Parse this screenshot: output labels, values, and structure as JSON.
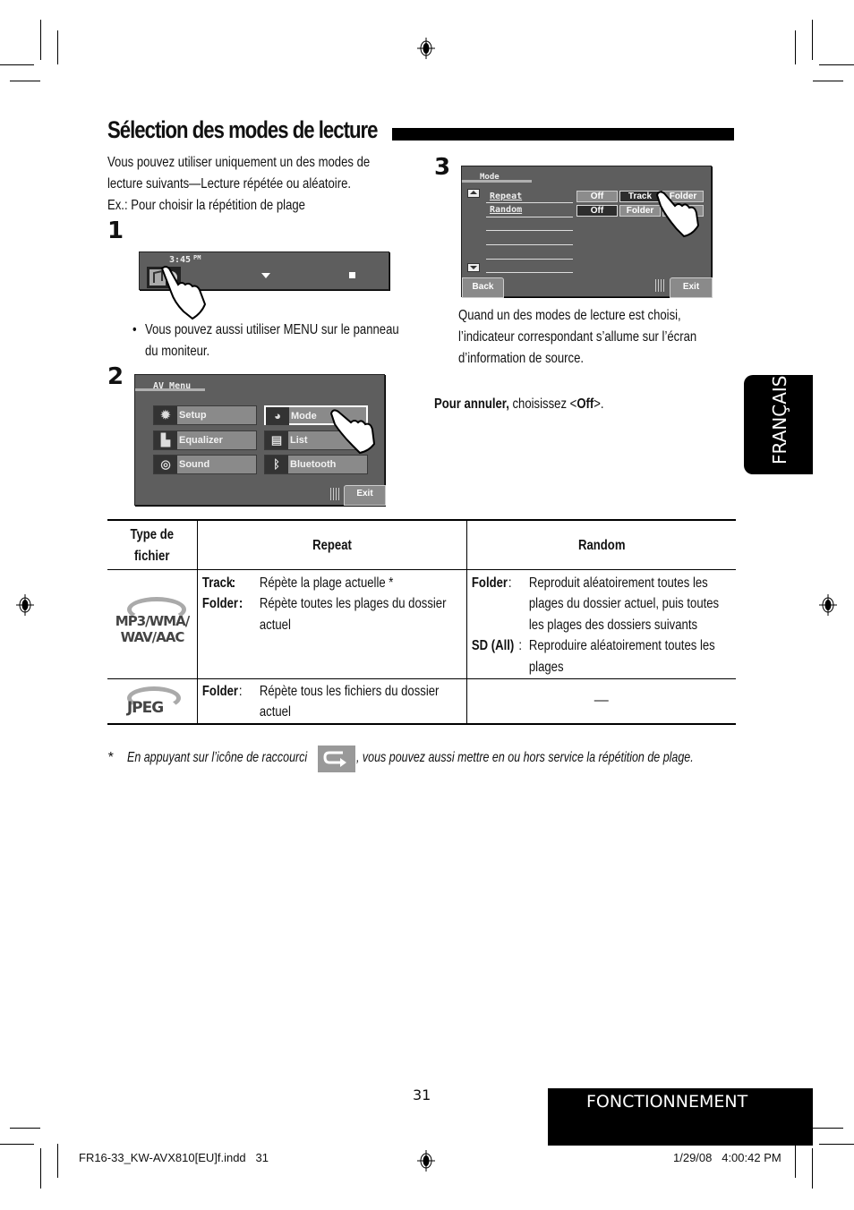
{
  "page": {
    "title": "Sélection des modes de lecture",
    "intro_lines": [
      "Vous pouvez utiliser uniquement un des modes de",
      "lecture suivants—Lecture répétée ou aléatoire.",
      "Ex.: Pour choisir la répétition de plage"
    ],
    "steps": [
      "1",
      "2",
      "3"
    ],
    "step1": {
      "screen": {
        "time": "3:45",
        "ampm": "PM"
      },
      "note_bullet": "•",
      "note_lines": [
        "Vous pouvez aussi utiliser MENU sur le panneau",
        "du moniteur."
      ]
    },
    "step2": {
      "screen": {
        "header": "AV Menu",
        "items": [
          {
            "label": "Setup",
            "icon": "gear-icon",
            "glyph": "✹"
          },
          {
            "label": "Mode",
            "icon": "mode-icon",
            "glyph": "◕"
          },
          {
            "label": "Equalizer",
            "icon": "equalizer-icon",
            "glyph": "▙"
          },
          {
            "label": "List",
            "icon": "list-icon",
            "glyph": "▤"
          },
          {
            "label": "Sound",
            "icon": "sound-icon",
            "glyph": "◎"
          },
          {
            "label": "Bluetooth",
            "icon": "bluetooth-icon",
            "glyph": "ᛒ"
          }
        ],
        "exit": "Exit"
      }
    },
    "step3": {
      "screen": {
        "header": "Mode",
        "rows": [
          {
            "label": "Repeat",
            "options": [
              {
                "label": "Off",
                "selected": false
              },
              {
                "label": "Track",
                "selected": true
              },
              {
                "label": "Folder",
                "selected": false
              }
            ]
          },
          {
            "label": "Random",
            "options": [
              {
                "label": "Off",
                "selected": true
              },
              {
                "label": "Folder",
                "selected": false
              },
              {
                "label": "",
                "selected": false
              }
            ]
          }
        ],
        "back": "Back",
        "exit": "Exit"
      },
      "desc_lines": [
        "Quand un des modes de lecture est choisi,",
        "l’indicateur correspondant s’allume sur l’écran",
        "d’information de source."
      ],
      "cancel_bold": "Pour annuler,",
      "cancel_text": " choisissez <",
      "cancel_off": "Off",
      "cancel_end": ">."
    },
    "table": {
      "headers": [
        "Type de\nfichier",
        "Repeat",
        "Random"
      ],
      "header_type_lines": [
        "Type de",
        "fichier"
      ],
      "rows": [
        {
          "type_logo_lines": [
            "MP3/WMA/",
            "WAV/AAC"
          ],
          "repeat": [
            {
              "key": "Track",
              "lines": [
                "Répète la plage actuelle *"
              ]
            },
            {
              "key": "Folder",
              "lines": [
                "Répète toutes les plages du dossier",
                "actuel"
              ]
            }
          ],
          "random": [
            {
              "key": "Folder",
              "lines": [
                "Reproduit aléatoirement toutes les",
                "plages du dossier actuel, puis toutes",
                "les plages des dossiers suivants"
              ]
            },
            {
              "key": "SD (All)",
              "lines": [
                "Reproduire aléatoirement toutes les",
                "plages"
              ]
            }
          ]
        },
        {
          "type_logo_lines": [
            "JPEG"
          ],
          "repeat": [
            {
              "key": "Folder",
              "lines": [
                "Répète tous les fichiers du dossier",
                "actuel"
              ]
            }
          ],
          "random_dash": "—"
        }
      ]
    },
    "footnote": {
      "star": "*",
      "before": "En appuyant sur l’icône de raccourci",
      "after": ", vous pouvez aussi mettre en ou hors service la répétition de plage."
    },
    "language_tab": "FRANÇAIS",
    "page_number": "31",
    "section_label": "FONCTIONNEMENT",
    "slug_left": "FR16-33_KW-AVX810[EU]f.indd   31",
    "slug_right": "1/29/08   4:00:42 PM",
    "colors": {
      "screen_bg": "#5e5e5e",
      "button_bg": "#8a8a8a",
      "selected_bg": "#2d2d2d",
      "accent_black": "#000000"
    }
  }
}
